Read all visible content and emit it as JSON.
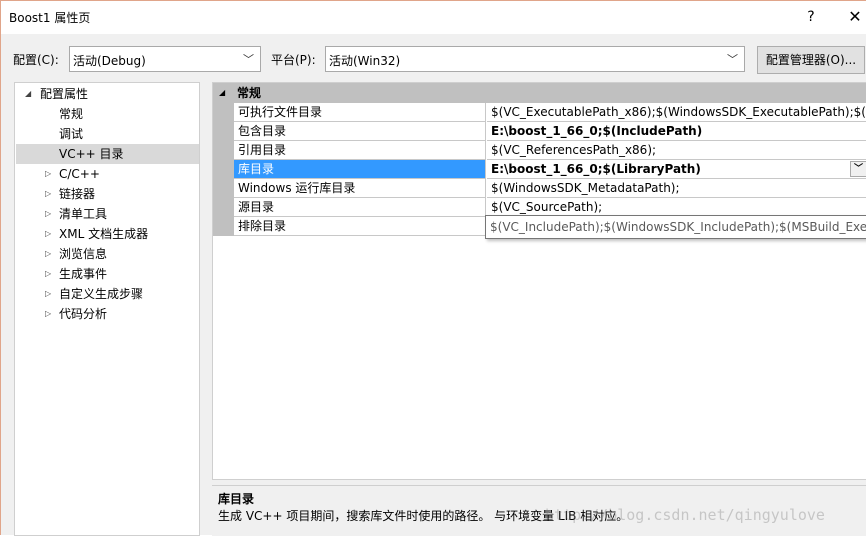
{
  "window": {
    "title": "Boost1 属性页",
    "help_label": "?",
    "close_label": "✕"
  },
  "config_bar": {
    "config_label": "配置(C):",
    "config_value": "活动(Debug)",
    "platform_label": "平台(P):",
    "platform_value": "活动(Win32)",
    "manager_button": "配置管理器(O)..."
  },
  "tree": {
    "items": [
      {
        "label": "配置属性",
        "expander": "◢"
      },
      {
        "label": "常规",
        "expander": ""
      },
      {
        "label": "调试",
        "expander": ""
      },
      {
        "label": "VC++ 目录",
        "expander": ""
      },
      {
        "label": "C/C++",
        "expander": "▷"
      },
      {
        "label": "链接器",
        "expander": "▷"
      },
      {
        "label": "清单工具",
        "expander": "▷"
      },
      {
        "label": "XML 文档生成器",
        "expander": "▷"
      },
      {
        "label": "浏览信息",
        "expander": "▷"
      },
      {
        "label": "生成事件",
        "expander": "▷"
      },
      {
        "label": "自定义生成步骤",
        "expander": "▷"
      },
      {
        "label": "代码分析",
        "expander": "▷"
      }
    ],
    "selected": "VC++ 目录"
  },
  "grid": {
    "category": "常规",
    "category_expander": "◢",
    "rows": [
      {
        "name": "可执行文件目录",
        "value": "$(VC_ExecutablePath_x86);$(WindowsSDK_ExecutablePath);$(VS_E"
      },
      {
        "name": "包含目录",
        "value": "E:\\boost_1_66_0;$(IncludePath)"
      },
      {
        "name": "引用目录",
        "value": "$(VC_ReferencesPath_x86);"
      },
      {
        "name": "库目录",
        "value": "E:\\boost_1_66_0;$(LibraryPath)"
      },
      {
        "name": "Windows 运行库目录",
        "value": "$(WindowsSDK_MetadataPath);"
      },
      {
        "name": "源目录",
        "value": "$(VC_SourcePath);"
      },
      {
        "name": "排除目录",
        "value": ""
      }
    ],
    "tooltip": "$(VC_IncludePath);$(WindowsSDK_IncludePath);$(MSBuild_Executa"
  },
  "description": {
    "title": "库目录",
    "text": "生成 VC++ 项目期间，搜索库文件时使用的路径。 与环境变量 LIB 相对应。"
  },
  "watermark": "http://blog.csdn.net/qingyulove"
}
